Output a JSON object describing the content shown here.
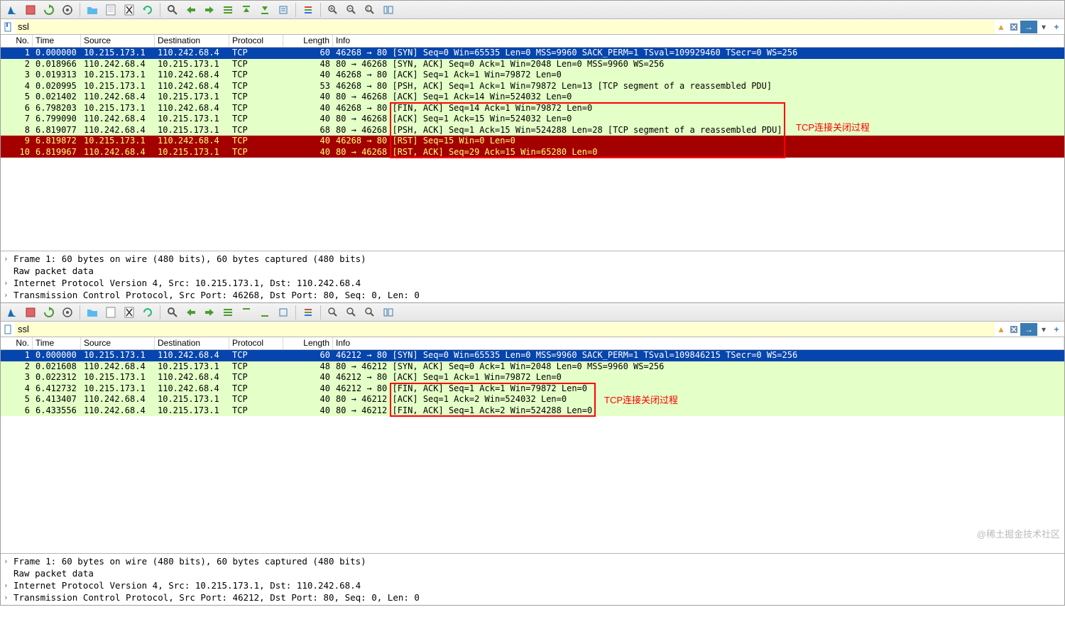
{
  "filter_value": "ssl",
  "columns": [
    "No.",
    "Time",
    "Source",
    "Destination",
    "Protocol",
    "Length",
    "Info"
  ],
  "pane1": {
    "rows": [
      {
        "no": "1",
        "time": "0.000000",
        "src": "10.215.173.1",
        "dst": "110.242.68.4",
        "proto": "TCP",
        "len": "60",
        "info": "46268 → 80 [SYN] Seq=0 Win=65535 Len=0 MSS=9960 SACK_PERM=1 TSval=109929460 TSecr=0 WS=256",
        "cls": "row-blue"
      },
      {
        "no": "2",
        "time": "0.018966",
        "src": "110.242.68.4",
        "dst": "10.215.173.1",
        "proto": "TCP",
        "len": "48",
        "info": "80 → 46268 [SYN, ACK] Seq=0 Ack=1 Win=2048 Len=0 MSS=9960 WS=256",
        "cls": "row-green"
      },
      {
        "no": "3",
        "time": "0.019313",
        "src": "10.215.173.1",
        "dst": "110.242.68.4",
        "proto": "TCP",
        "len": "40",
        "info": "46268 → 80 [ACK] Seq=1 Ack=1 Win=79872 Len=0",
        "cls": "row-green"
      },
      {
        "no": "4",
        "time": "0.020995",
        "src": "10.215.173.1",
        "dst": "110.242.68.4",
        "proto": "TCP",
        "len": "53",
        "info": "46268 → 80 [PSH, ACK] Seq=1 Ack=1 Win=79872 Len=13 [TCP segment of a reassembled PDU]",
        "cls": "row-green"
      },
      {
        "no": "5",
        "time": "0.021402",
        "src": "110.242.68.4",
        "dst": "10.215.173.1",
        "proto": "TCP",
        "len": "40",
        "info": "80 → 46268 [ACK] Seq=1 Ack=14 Win=524032 Len=0",
        "cls": "row-green"
      },
      {
        "no": "6",
        "time": "6.798203",
        "src": "10.215.173.1",
        "dst": "110.242.68.4",
        "proto": "TCP",
        "len": "40",
        "info": "46268 → 80 [FIN, ACK] Seq=14 Ack=1 Win=79872 Len=0",
        "cls": "row-green"
      },
      {
        "no": "7",
        "time": "6.799090",
        "src": "110.242.68.4",
        "dst": "10.215.173.1",
        "proto": "TCP",
        "len": "40",
        "info": "80 → 46268 [ACK] Seq=1 Ack=15 Win=524032 Len=0",
        "cls": "row-green"
      },
      {
        "no": "8",
        "time": "6.819077",
        "src": "110.242.68.4",
        "dst": "10.215.173.1",
        "proto": "TCP",
        "len": "68",
        "info": "80 → 46268 [PSH, ACK] Seq=1 Ack=15 Win=524288 Len=28 [TCP segment of a reassembled PDU]",
        "cls": "row-green"
      },
      {
        "no": "9",
        "time": "6.819872",
        "src": "10.215.173.1",
        "dst": "110.242.68.4",
        "proto": "TCP",
        "len": "40",
        "info": "46268 → 80 [RST] Seq=15 Win=0 Len=0",
        "cls": "row-red"
      },
      {
        "no": "10",
        "time": "6.819967",
        "src": "110.242.68.4",
        "dst": "10.215.173.1",
        "proto": "TCP",
        "len": "40",
        "info": "80 → 46268 [RST, ACK] Seq=29 Ack=15 Win=65280 Len=0",
        "cls": "row-red"
      }
    ],
    "annotation": "TCP连接关闭过程",
    "details": [
      "Frame 1: 60 bytes on wire (480 bits), 60 bytes captured (480 bits)",
      "Raw packet data",
      "Internet Protocol Version 4, Src: 10.215.173.1, Dst: 110.242.68.4",
      "Transmission Control Protocol, Src Port: 46268, Dst Port: 80, Seq: 0, Len: 0"
    ]
  },
  "pane2": {
    "rows": [
      {
        "no": "1",
        "time": "0.000000",
        "src": "10.215.173.1",
        "dst": "110.242.68.4",
        "proto": "TCP",
        "len": "60",
        "info": "46212 → 80 [SYN] Seq=0 Win=65535 Len=0 MSS=9960 SACK_PERM=1 TSval=109846215 TSecr=0 WS=256",
        "cls": "row-blue"
      },
      {
        "no": "2",
        "time": "0.021608",
        "src": "110.242.68.4",
        "dst": "10.215.173.1",
        "proto": "TCP",
        "len": "48",
        "info": "80 → 46212 [SYN, ACK] Seq=0 Ack=1 Win=2048 Len=0 MSS=9960 WS=256",
        "cls": "row-green"
      },
      {
        "no": "3",
        "time": "0.022312",
        "src": "10.215.173.1",
        "dst": "110.242.68.4",
        "proto": "TCP",
        "len": "40",
        "info": "46212 → 80 [ACK] Seq=1 Ack=1 Win=79872 Len=0",
        "cls": "row-green"
      },
      {
        "no": "4",
        "time": "6.412732",
        "src": "10.215.173.1",
        "dst": "110.242.68.4",
        "proto": "TCP",
        "len": "40",
        "info": "46212 → 80 [FIN, ACK] Seq=1 Ack=1 Win=79872 Len=0",
        "cls": "row-green"
      },
      {
        "no": "5",
        "time": "6.413407",
        "src": "110.242.68.4",
        "dst": "10.215.173.1",
        "proto": "TCP",
        "len": "40",
        "info": "80 → 46212 [ACK] Seq=1 Ack=2 Win=524032 Len=0",
        "cls": "row-green"
      },
      {
        "no": "6",
        "time": "6.433556",
        "src": "110.242.68.4",
        "dst": "10.215.173.1",
        "proto": "TCP",
        "len": "40",
        "info": "80 → 46212 [FIN, ACK] Seq=1 Ack=2 Win=524288 Len=0",
        "cls": "row-green"
      }
    ],
    "annotation": "TCP连接关闭过程",
    "details": [
      "Frame 1: 60 bytes on wire (480 bits), 60 bytes captured (480 bits)",
      "Raw packet data",
      "Internet Protocol Version 4, Src: 10.215.173.1, Dst: 110.242.68.4",
      "Transmission Control Protocol, Src Port: 46212, Dst Port: 80, Seq: 0, Len: 0"
    ]
  },
  "watermark": "@稀土掘金技术社区"
}
